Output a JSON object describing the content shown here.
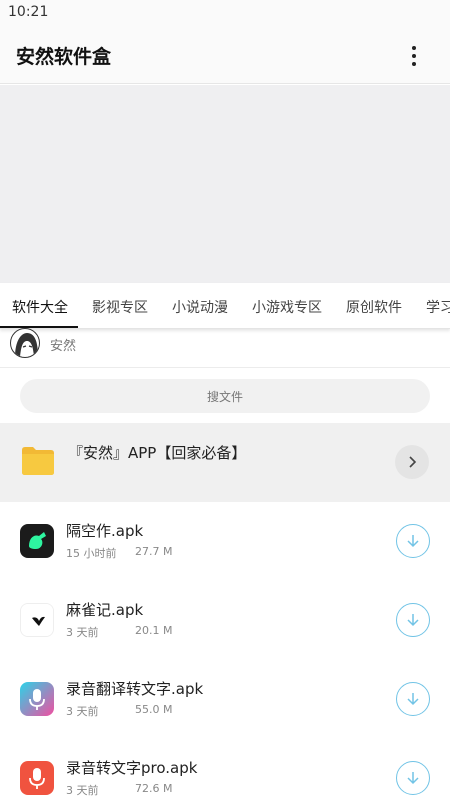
{
  "status_bar": {
    "time": "10:21"
  },
  "app_bar": {
    "title": "安然软件盒",
    "more_icon": "more-vert-icon"
  },
  "tabs": [
    {
      "label": "软件大全",
      "active": true
    },
    {
      "label": "影视专区",
      "active": false
    },
    {
      "label": "小说动漫",
      "active": false
    },
    {
      "label": "小游戏专区",
      "active": false
    },
    {
      "label": "原创软件",
      "active": false
    },
    {
      "label": "学习",
      "active": false
    }
  ],
  "author": {
    "name": "安然"
  },
  "search": {
    "placeholder": "搜文件"
  },
  "folder": {
    "name": "『安然』APP【回家必备】",
    "icon": "folder-icon",
    "color": "#f7c940"
  },
  "files": [
    {
      "name": "隔空作.apk",
      "time": "15 小时前",
      "size": "27.7 M"
    },
    {
      "name": "麻雀记.apk",
      "time": "3 天前",
      "size": "20.1 M"
    },
    {
      "name": "录音翻译转文字.apk",
      "time": "3 天前",
      "size": "55.0 M"
    },
    {
      "name": "录音转文字pro.apk",
      "time": "3 天前",
      "size": "72.6 M"
    }
  ],
  "colors": {
    "accent": "#72c4e6",
    "tab_indicator": "#111111"
  }
}
